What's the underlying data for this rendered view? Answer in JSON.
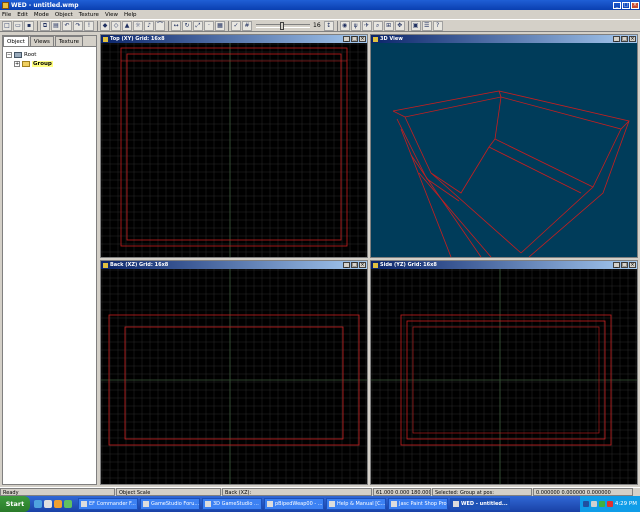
{
  "window": {
    "title": "WED - untitled.wmp"
  },
  "menu": [
    "File",
    "Edit",
    "Mode",
    "Object",
    "Texture",
    "View",
    "Help"
  ],
  "toolbar": {
    "grid_value": "16"
  },
  "left_panel": {
    "tabs": [
      "Object",
      "Views",
      "Texture"
    ],
    "tree": {
      "root": "Root",
      "child": "Group"
    }
  },
  "viewports": {
    "top": {
      "title": "Top (XY) Grid: 16x8"
    },
    "view3d": {
      "title": "3D View"
    },
    "back": {
      "title": "Back (XZ) Grid: 16x8"
    },
    "side": {
      "title": "Side (YZ) Grid: 16x8"
    }
  },
  "status": {
    "ready": "Ready",
    "object_scale": "Object Scale",
    "view": "Back (XZ):",
    "coords": "61.000 0.000 180.000",
    "selected": "Selected: Group at pos:",
    "pos": "0.000000 0.000000 0.000000"
  },
  "taskbar": {
    "start": "Start",
    "tasks": [
      "EF Commander F...",
      "GameStudio Foru...",
      "3D GameStudio ...",
      "pBipedWeap00 - ...",
      "Help & Manual [C...",
      "Jasc Paint Shop Pro",
      "WED - untitled..."
    ],
    "clock": "4:29 PM"
  },
  "colors": {
    "viewport_bg": "#000000",
    "view3d_bg": "#003c5a",
    "grid": "#2a2a2a",
    "axis": "#3a5a3a",
    "geometry": "#c81e1e"
  }
}
